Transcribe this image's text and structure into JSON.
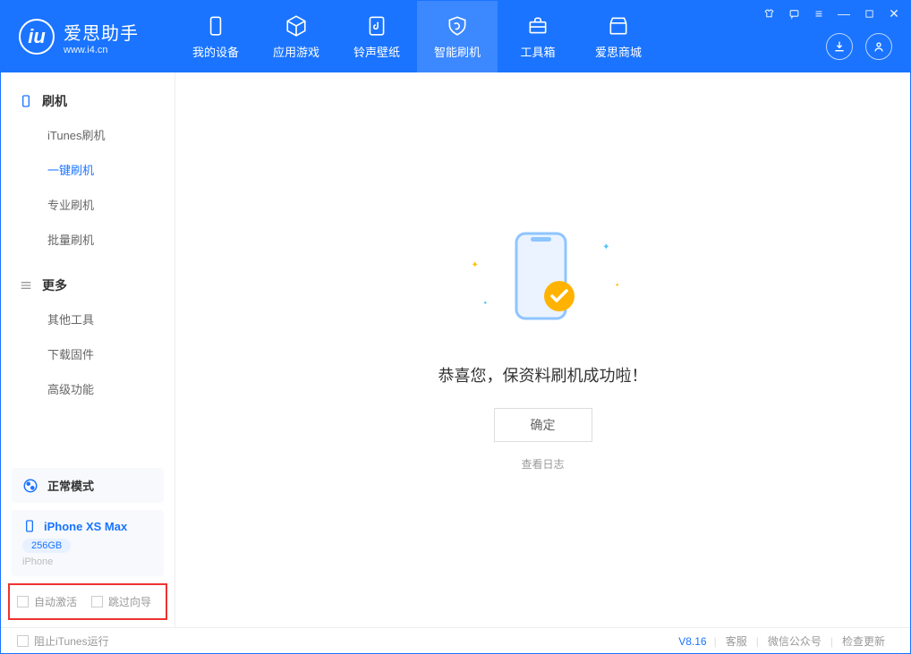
{
  "app": {
    "name": "爱思助手",
    "site": "www.i4.cn"
  },
  "nav": {
    "items": [
      {
        "label": "我的设备"
      },
      {
        "label": "应用游戏"
      },
      {
        "label": "铃声壁纸"
      },
      {
        "label": "智能刷机"
      },
      {
        "label": "工具箱"
      },
      {
        "label": "爱思商城"
      }
    ]
  },
  "sidebar": {
    "section1": {
      "title": "刷机",
      "items": [
        {
          "label": "iTunes刷机"
        },
        {
          "label": "一键刷机"
        },
        {
          "label": "专业刷机"
        },
        {
          "label": "批量刷机"
        }
      ]
    },
    "section2": {
      "title": "更多",
      "items": [
        {
          "label": "其他工具"
        },
        {
          "label": "下载固件"
        },
        {
          "label": "高级功能"
        }
      ]
    },
    "mode": "正常模式",
    "device": {
      "name": "iPhone XS Max",
      "capacity": "256GB",
      "type": "iPhone"
    },
    "checks": {
      "auto_activate": "自动激活",
      "skip_guide": "跳过向导"
    }
  },
  "main": {
    "message": "恭喜您，保资料刷机成功啦！",
    "ok": "确定",
    "view_log": "查看日志"
  },
  "footer": {
    "stop_itunes": "阻止iTunes运行",
    "version": "V8.16",
    "links": {
      "cs": "客服",
      "wechat": "微信公众号",
      "update": "检查更新"
    }
  }
}
